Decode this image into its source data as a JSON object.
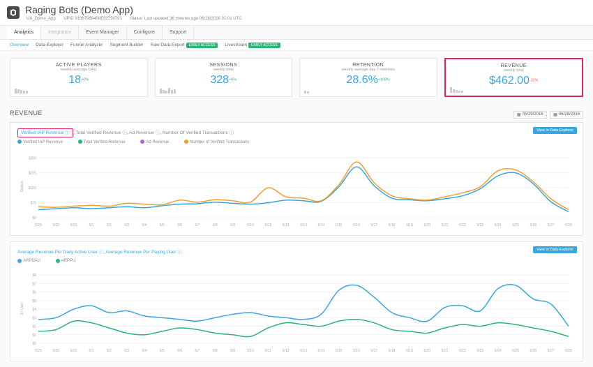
{
  "header": {
    "title": "Raging Bots (Demo App)",
    "meta_app": "UA_Demo_App",
    "meta_upid": "UPID 91967568408E93759791",
    "meta_status": "Status: Last updated 36 minutes ago 06/28/2016 01:01 UTC"
  },
  "tabs1": {
    "analytics": "Analytics",
    "integration": "Integration",
    "event_manager": "Event Manager",
    "configure": "Configure",
    "support": "Support"
  },
  "tabs2": {
    "overview": "Overview",
    "data_explorer": "Data Explorer",
    "funnel": "Funnel Analyzer",
    "segment": "Segment Builder",
    "raw": "Raw Data Export",
    "livestream": "Livestream",
    "badge": "EARLY ACCESS"
  },
  "metrics": {
    "active_players": {
      "title": "ACTIVE PLAYERS",
      "sub": "weekly average DAU",
      "val": "18",
      "delta": "+0%"
    },
    "sessions": {
      "title": "SESSIONS",
      "sub": "weekly total",
      "val": "328",
      "delta": "+6%"
    },
    "retention": {
      "title": "RETENTION",
      "sub": "weekly average day 7 retention",
      "val": "28.6%",
      "delta": "+198%"
    },
    "revenue": {
      "title": "REVENUE",
      "sub": "weekly total",
      "val": "$462.00",
      "delta": "-11%"
    }
  },
  "section_title": "REVENUE",
  "dates": {
    "from": "05/29/2016",
    "to": "06/28/2016"
  },
  "chart1": {
    "filters": {
      "verified_iap": "Verified IAP Revenue",
      "total_verified": "Total Verified Revenue",
      "ad": "Ad Revenue",
      "num_tx": "Number Of Verified Transactions"
    },
    "legend": {
      "verified_iap": "Verified IAP Revenue",
      "total_verified": "Total Verified Revenue",
      "ad": "Ad Revenue",
      "num_tx": "Number of Verified Transactions"
    },
    "view_btn": "View in Data Explorer",
    "ylabel": "Dollars"
  },
  "chart2": {
    "filters": {
      "arpdau": "Average Revenue Per Daily Active User",
      "arppu": "Average Revenue Per Paying User"
    },
    "legend": {
      "arpdau": "ARPDAU",
      "arppu": "ARPPU"
    },
    "view_btn": "View in Data Explorer",
    "ylabel": "$ / User"
  },
  "chart_data": [
    {
      "type": "line",
      "title": "Revenue",
      "xlabel": "",
      "ylabel": "Dollars",
      "ylim": [
        0,
        350
      ],
      "x": [
        "5/29",
        "5/30",
        "5/31",
        "6/1",
        "6/2",
        "6/3",
        "6/4",
        "6/5",
        "6/6",
        "6/7",
        "6/8",
        "6/9",
        "6/10",
        "6/11",
        "6/12",
        "6/13",
        "6/14",
        "6/15",
        "6/16",
        "6/17",
        "6/18",
        "6/19",
        "6/20",
        "6/21",
        "6/22",
        "6/23",
        "6/24",
        "6/25",
        "6/26",
        "6/27",
        "6/28"
      ],
      "series": [
        {
          "name": "Total Verified Revenue",
          "color": "#3aa6dd",
          "values": [
            40,
            45,
            50,
            45,
            50,
            55,
            50,
            60,
            68,
            70,
            78,
            72,
            68,
            75,
            88,
            85,
            82,
            155,
            255,
            160,
            98,
            90,
            85,
            95,
            110,
            145,
            210,
            225,
            170,
            80,
            30
          ]
        },
        {
          "name": "Number of Verified Transactions",
          "color": "#f0a030",
          "values": [
            55,
            52,
            58,
            62,
            58,
            72,
            68,
            65,
            88,
            78,
            90,
            85,
            78,
            150,
            105,
            98,
            85,
            165,
            280,
            175,
            110,
            95,
            88,
            105,
            125,
            155,
            235,
            240,
            180,
            95,
            40
          ]
        }
      ],
      "yticks": [
        0,
        75,
        150,
        225,
        300
      ]
    },
    {
      "type": "line",
      "title": "Average Revenue per User",
      "xlabel": "",
      "ylabel": "$ / User",
      "ylim": [
        0,
        9
      ],
      "x": [
        "5/29",
        "5/30",
        "5/31",
        "6/1",
        "6/2",
        "6/3",
        "6/4",
        "6/5",
        "6/6",
        "6/7",
        "6/8",
        "6/9",
        "6/10",
        "6/11",
        "6/12",
        "6/13",
        "6/14",
        "6/15",
        "6/16",
        "6/17",
        "6/18",
        "6/19",
        "6/20",
        "6/21",
        "6/22",
        "6/23",
        "6/24",
        "6/25",
        "6/26",
        "6/27",
        "6/28"
      ],
      "series": [
        {
          "name": "ARPDAU",
          "color": "#3aa6dd",
          "values": [
            2.8,
            3.0,
            4.0,
            4.4,
            3.6,
            3.8,
            3.2,
            3.0,
            2.8,
            2.6,
            3.0,
            3.4,
            3.6,
            3.2,
            3.0,
            2.8,
            3.4,
            6.2,
            6.8,
            5.4,
            3.6,
            3.0,
            2.6,
            4.2,
            4.4,
            3.8,
            6.4,
            6.8,
            5.2,
            4.6,
            2.0
          ]
        },
        {
          "name": "ARPPU",
          "color": "#2cb673",
          "values": [
            1.4,
            1.6,
            2.6,
            2.4,
            1.8,
            1.2,
            1.0,
            1.4,
            1.8,
            1.6,
            1.2,
            1.0,
            0.8,
            1.8,
            2.4,
            2.2,
            2.0,
            2.6,
            2.8,
            2.4,
            1.6,
            1.4,
            1.2,
            1.8,
            2.2,
            2.0,
            2.4,
            2.2,
            1.8,
            1.4,
            0.8
          ]
        }
      ],
      "yticks": [
        0,
        1,
        2,
        3,
        4,
        5,
        6,
        7,
        8
      ]
    }
  ]
}
